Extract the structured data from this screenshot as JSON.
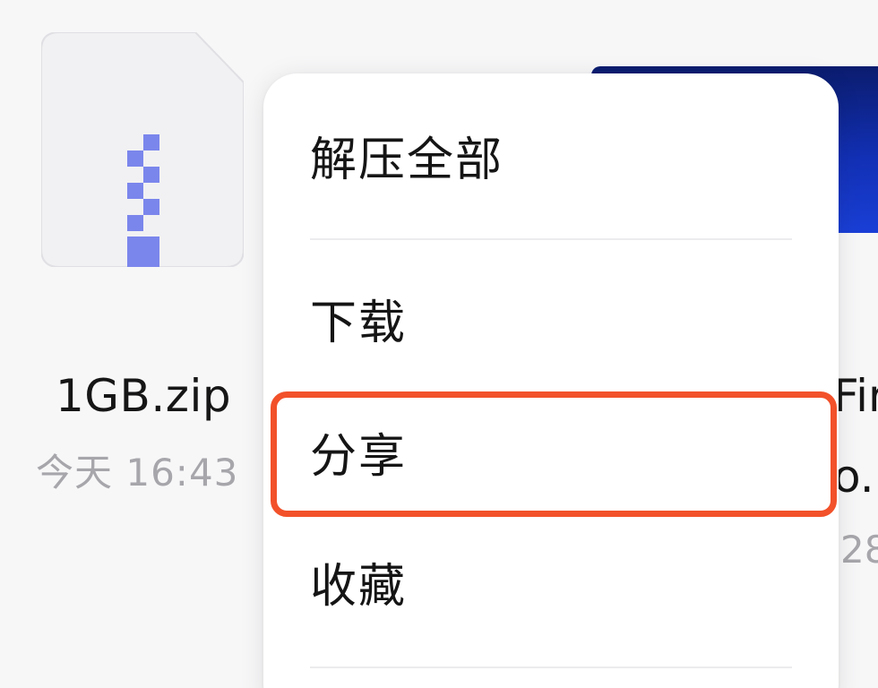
{
  "file": {
    "name": "1GB.zip",
    "time": "今天 16:43",
    "icon": "zip-archive-icon",
    "accent": "#7b86ec"
  },
  "neighbor": {
    "name_fragment": "Fir",
    "ext_fragment": "o.n",
    "time_fragment": "28"
  },
  "menu": {
    "items": [
      {
        "label": "解压全部"
      },
      {
        "label": "下载"
      },
      {
        "label": "分享"
      },
      {
        "label": "收藏"
      }
    ]
  },
  "highlight": {
    "target": "分享",
    "color": "#f2512a"
  }
}
